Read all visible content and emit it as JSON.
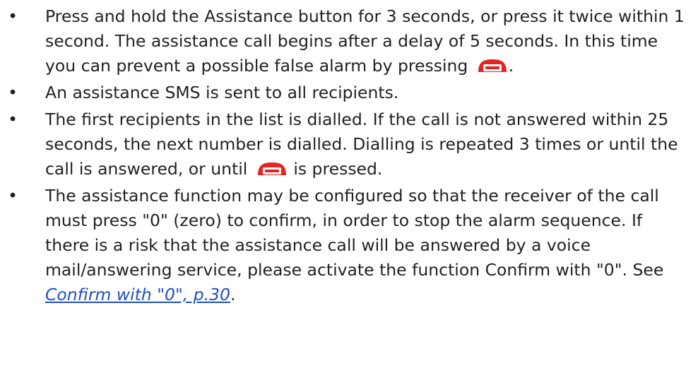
{
  "bullet_symbol": "•",
  "icons": {
    "end_key": "red-end-call-key-icon",
    "end_key_color": "#e52421"
  },
  "link_color": "#1f4fbf",
  "items": [
    {
      "text_before_icon": "Press and hold the Assistance button for 3 seconds, or press it twice within 1 second. The assistance call begins after a delay of 5 seconds. In this time you can prevent a possible false alarm by pressing",
      "text_after_icon": "."
    },
    {
      "text": "An assistance SMS is sent to all recipients."
    },
    {
      "text_before_icon": "The first recipients in the list is dialled.  If the call is not answered within 25 seconds, the next number is dialled. Dialling is repeated 3 times or until the call is answered, or until",
      "text_after_icon": "is pressed."
    },
    {
      "text_before_link": "The assistance function may be configured so that the receiver of the call must press \"0\" (zero) to confirm, in order to stop the alarm sequence. If there is a risk that the assistance call will be answered by a voice mail/answering service, please activate the function Confirm with \"0\". See",
      "link_text": "Confirm with \"0\", p.30",
      "text_after_link": "."
    }
  ]
}
